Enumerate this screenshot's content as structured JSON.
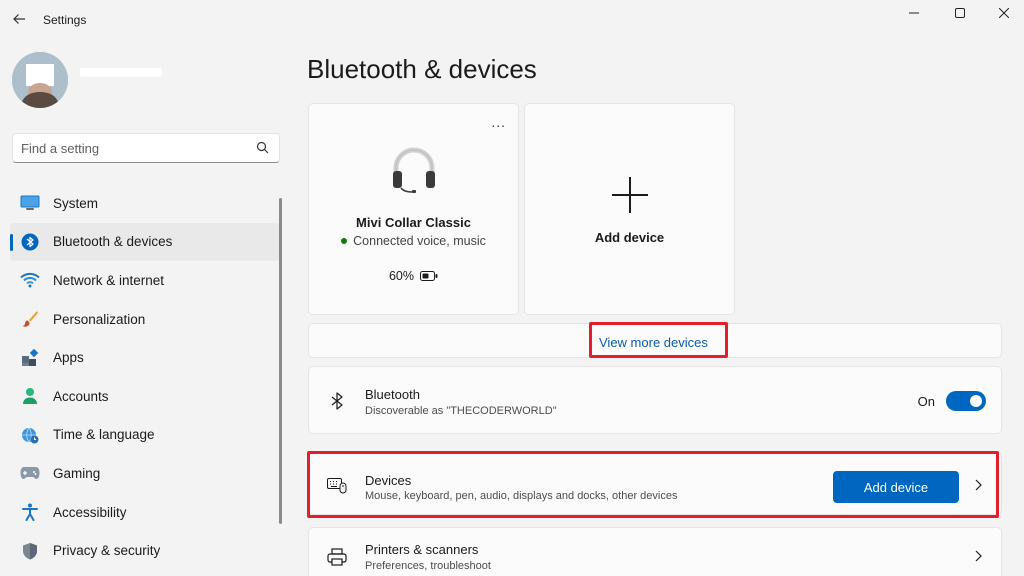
{
  "window": {
    "title": "Settings"
  },
  "search": {
    "placeholder": "Find a setting"
  },
  "nav": {
    "items": [
      {
        "label": "System",
        "icon": "monitor-icon"
      },
      {
        "label": "Bluetooth & devices",
        "icon": "bluetooth-icon",
        "active": true
      },
      {
        "label": "Network & internet",
        "icon": "wifi-icon"
      },
      {
        "label": "Personalization",
        "icon": "brush-icon"
      },
      {
        "label": "Apps",
        "icon": "apps-icon"
      },
      {
        "label": "Accounts",
        "icon": "person-icon"
      },
      {
        "label": "Time & language",
        "icon": "globe-clock-icon"
      },
      {
        "label": "Gaming",
        "icon": "gamepad-icon"
      },
      {
        "label": "Accessibility",
        "icon": "accessibility-icon"
      },
      {
        "label": "Privacy & security",
        "icon": "shield-icon"
      }
    ]
  },
  "main": {
    "title": "Bluetooth & devices",
    "device_card": {
      "name": "Mivi Collar Classic",
      "status": "Connected voice, music",
      "battery": "60%",
      "more": "..."
    },
    "add_card": {
      "label": "Add device"
    },
    "view_more": "View more devices",
    "bluetooth": {
      "title": "Bluetooth",
      "subtitle": "Discoverable as \"THECODERWORLD\"",
      "toggle_label": "On"
    },
    "devices": {
      "title": "Devices",
      "subtitle": "Mouse, keyboard, pen, audio, displays and docks, other devices",
      "button": "Add device"
    },
    "printers": {
      "title": "Printers & scanners",
      "subtitle": "Preferences, troubleshoot"
    }
  },
  "colors": {
    "accent": "#0067c0",
    "highlight": "#e01e2c",
    "connected": "#0f7b0f"
  }
}
